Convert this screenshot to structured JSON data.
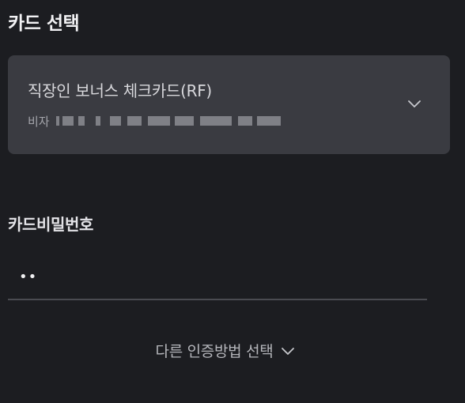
{
  "header": {
    "title": "카드 선택"
  },
  "card_select": {
    "card_name": "직장인 보너스 체크카드(RF)",
    "card_brand": "비자",
    "card_number_masked": "",
    "expand_icon": "chevron-down-icon"
  },
  "password": {
    "label": "카드비밀번호",
    "value_display": "••"
  },
  "alt_auth": {
    "label": "다른 인증방법 선택",
    "icon": "chevron-down-icon"
  },
  "colors": {
    "background": "#1c1d21",
    "card_bg": "#3a3b41",
    "divider": "#4a4b51"
  }
}
